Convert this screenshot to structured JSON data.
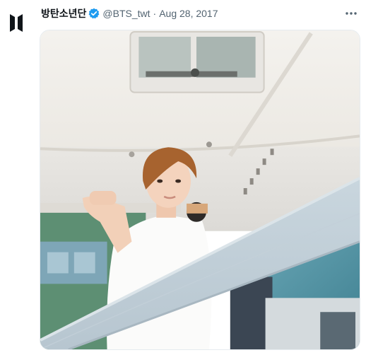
{
  "tweet": {
    "display_name": "방탄소년단",
    "handle": "@BTS_twt",
    "separator": "·",
    "date": "Aug 28, 2017"
  },
  "icons": {
    "avatar": "bts-logo-icon",
    "verified": "verified-badge-icon",
    "more": "more-options-icon"
  },
  "colors": {
    "verified_blue": "#1d9bf0",
    "secondary_text": "#536471",
    "primary_text": "#0f1419"
  }
}
